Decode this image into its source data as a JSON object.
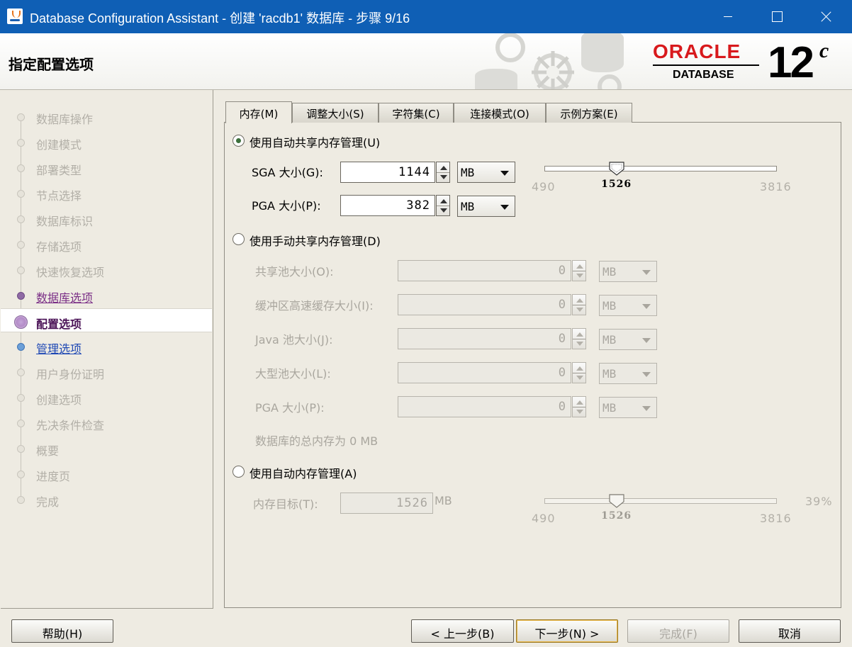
{
  "window": {
    "title": "Database Configuration Assistant - 创建 'racdb1' 数据库 - 步骤 9/16"
  },
  "header": {
    "page_title": "指定配置选项",
    "logo": {
      "brand": "ORACLE",
      "product": "DATABASE",
      "version": "12",
      "version_suffix": "c"
    }
  },
  "steps": [
    {
      "label": "数据库操作",
      "state": "disabled"
    },
    {
      "label": "创建模式",
      "state": "disabled"
    },
    {
      "label": "部署类型",
      "state": "disabled"
    },
    {
      "label": "节点选择",
      "state": "disabled"
    },
    {
      "label": "数据库标识",
      "state": "disabled"
    },
    {
      "label": "存储选项",
      "state": "disabled"
    },
    {
      "label": "快速恢复选项",
      "state": "disabled"
    },
    {
      "label": "数据库选项",
      "state": "done"
    },
    {
      "label": "配置选项",
      "state": "current"
    },
    {
      "label": "管理选项",
      "state": "next"
    },
    {
      "label": "用户身份证明",
      "state": "disabled"
    },
    {
      "label": "创建选项",
      "state": "disabled"
    },
    {
      "label": "先决条件检查",
      "state": "disabled"
    },
    {
      "label": "概要",
      "state": "disabled"
    },
    {
      "label": "进度页",
      "state": "disabled"
    },
    {
      "label": "完成",
      "state": "disabled"
    }
  ],
  "tabs": [
    {
      "label": "内存(M)",
      "active": true
    },
    {
      "label": "调整大小(S)",
      "active": false
    },
    {
      "label": "字符集(C)",
      "active": false
    },
    {
      "label": "连接模式(O)",
      "active": false
    },
    {
      "label": "示例方案(E)",
      "active": false
    }
  ],
  "memory": {
    "asmm": {
      "label": "使用自动共享内存管理(U)",
      "selected": true,
      "sga_label": "SGA 大小(G):",
      "sga_value": "1144",
      "sga_unit": "MB",
      "pga_label": "PGA 大小(P):",
      "pga_value": "382",
      "pga_unit": "MB",
      "slider": {
        "min": "490",
        "max": "3816",
        "value": "1526",
        "value_num": 1526,
        "min_num": 490,
        "max_num": 3816
      }
    },
    "manual": {
      "label": "使用手动共享内存管理(D)",
      "selected": false,
      "fields": [
        {
          "label": "共享池大小(O):",
          "value": "0",
          "unit": "MB"
        },
        {
          "label": "缓冲区高速缓存大小(I):",
          "value": "0",
          "unit": "MB"
        },
        {
          "label": "Java 池大小(J):",
          "value": "0",
          "unit": "MB"
        },
        {
          "label": "大型池大小(L):",
          "value": "0",
          "unit": "MB"
        },
        {
          "label": "PGA 大小(P):",
          "value": "0",
          "unit": "MB"
        }
      ],
      "total_text": "数据库的总内存为 0 MB"
    },
    "amm": {
      "label": "使用自动内存管理(A)",
      "selected": false,
      "target_label": "内存目标(T):",
      "target_value": "1526",
      "target_unit": "MB",
      "percent": "39%",
      "slider": {
        "min": "490",
        "max": "3816",
        "value": "1526",
        "value_num": 1526,
        "min_num": 490,
        "max_num": 3816
      }
    }
  },
  "buttons": {
    "help": "帮助(H)",
    "back": "< 上一步(B)",
    "next": "下一步(N) >",
    "finish": "完成(F)",
    "cancel": "取消"
  }
}
